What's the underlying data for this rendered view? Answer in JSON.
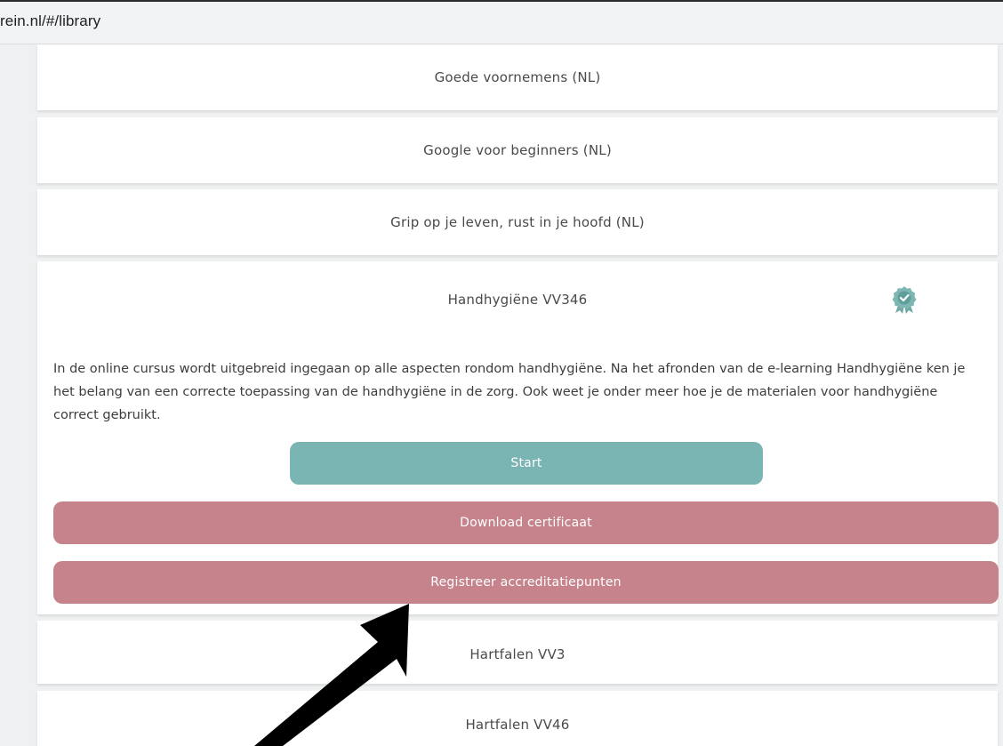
{
  "browser": {
    "url": "rein.nl/#/library"
  },
  "library": {
    "items": [
      {
        "title": "Goede voornemens (NL)"
      },
      {
        "title": "Google voor beginners (NL)"
      },
      {
        "title": "Grip op je leven, rust in je hoofd (NL)"
      },
      {
        "title": "Handhygiëne VV346",
        "badge_icon": "certificate-ribbon-icon",
        "description": "In de online cursus wordt uitgebreid ingegaan op alle aspecten rondom handhygiëne. Na het afronden van de e-learning Handhygiëne ken je het belang van een correcte toepassing van de handhygiëne in de zorg. Ook weet je onder meer hoe je de materialen voor handhygiëne correct gebruikt.",
        "start_label": "Start",
        "download_label": "Download certificaat",
        "register_label": "Registreer accreditatiepunten"
      },
      {
        "title": "Hartfalen VV3"
      },
      {
        "title": "Hartfalen VV46"
      }
    ]
  },
  "colors": {
    "start_button": "#7ab5b3",
    "action_button": "#c6838c",
    "badge": "#6fa9a6"
  }
}
